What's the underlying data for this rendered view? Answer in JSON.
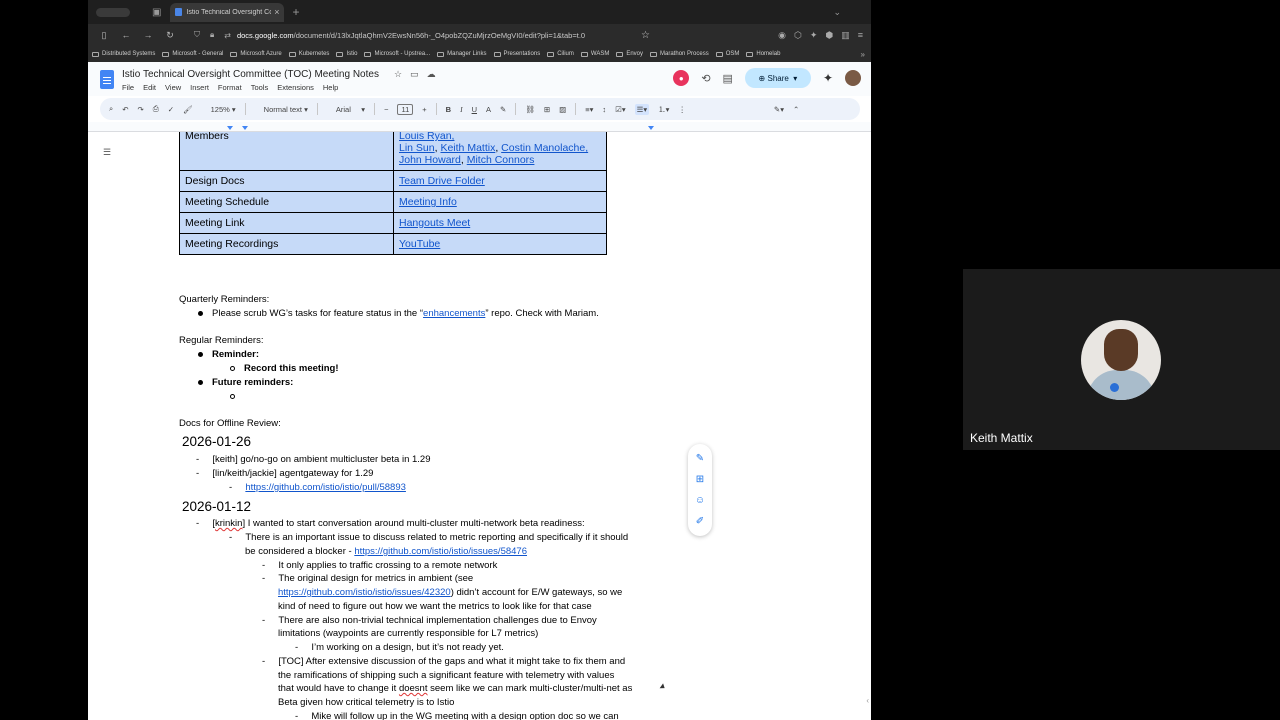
{
  "browser": {
    "tab_title": "Istio Technical Oversight Committee (TOC) Meeting Notes",
    "url_prefix": "docs.google.com",
    "url_rest": "/document/d/13lxJqtlaQhmV2EwsNn56h-_O4pobZQZuMjrzOeMgVI0/edit?pli=1&tab=t.0",
    "bookmarks": [
      "Distributed Systems",
      "Microsoft - General",
      "Microsoft Azure",
      "Kubernetes",
      "Istio",
      "Microsoft - Upstrea...",
      "Manager Links",
      "Presentations",
      "Cilium",
      "WASM",
      "Envoy",
      "Marathon Process",
      "OSM",
      "Homelab"
    ]
  },
  "docs": {
    "title": "Istio Technical Oversight Committee (TOC) Meeting Notes",
    "menus": [
      "File",
      "Edit",
      "View",
      "Insert",
      "Format",
      "Tools",
      "Extensions",
      "Help"
    ],
    "share_label": "Share",
    "zoom": "125%",
    "style": "Normal text",
    "font": "Arial",
    "font_size": "11"
  },
  "table": [
    {
      "key": "Members",
      "links": [
        [
          "Louis Ryan,"
        ],
        [
          "Lin Sun",
          ", ",
          "Keith Mattix",
          ", ",
          "Costin Manolache,"
        ],
        [
          "John Howard",
          ", ",
          "Mitch Connors"
        ]
      ]
    },
    {
      "key": "Design Docs",
      "value": "Team Drive Folder"
    },
    {
      "key": "Meeting Schedule",
      "value": "Meeting Info"
    },
    {
      "key": "Meeting Link",
      "value": "Hangouts Meet"
    },
    {
      "key": "Meeting Recordings",
      "value": "YouTube"
    }
  ],
  "content": {
    "quarterly_heading": "Quarterly Reminders:",
    "quarterly_pre": "Please scrub WG’s tasks for feature status in the “",
    "quarterly_link": "enhancements",
    "quarterly_post": "” repo. Check with Mariam.",
    "regular_heading": "Regular Reminders:",
    "reminder_label": "Reminder:",
    "record_label": "Record this meeting!",
    "future_label": "Future reminders:",
    "offline_heading": "Docs for Offline Review:",
    "date1": "2026-01-26",
    "d1_item1": "[keith] go/no-go on ambient multicluster beta in 1.29",
    "d1_item2": "[lin/keith/jackie] agentgateway for 1.29",
    "d1_link": "https://github.com/istio/istio/pull/58893",
    "date2": "2026-01-12",
    "d2_krinkin": "krinkin",
    "d2_item1": "] I wanted to start conversation around multi-cluster multi-network beta readiness:",
    "d2_sub1_a": "There is an important issue to discuss related to metric reporting and specifically if it should",
    "d2_sub1_b": "be considered a blocker - ",
    "d2_sub1_link": "https://github.com/istio/istio/issues/58476",
    "d2_s1": "It only applies to traffic crossing to a remote network",
    "d2_s2_a": "The original design for metrics in ambient (see",
    "d2_s2_link": "https://github.com/istio/istio/issues/42320",
    "d2_s2_b": ") didn’t account for E/W gateways, so we",
    "d2_s2_c": "kind of need to figure out how we want the metrics to look like for that case",
    "d2_s3_a": "There are also non-trivial technical implementation challenges due to Envoy",
    "d2_s3_b": "limitations (waypoints are currently responsible for L7 metrics)",
    "d2_s3_sub": "I’m working on a design, but it’s not ready yet.",
    "d2_s4_a": "[TOC] After extensive discussion of the gaps and what it might take to fix them and",
    "d2_s4_b": "the ramifications of shipping such a significant feature with telemetry with values",
    "d2_s4_c_pre": "that would have to change it ",
    "d2_s4_c_sq": "doesnt",
    "d2_s4_c_post": " seem like we can mark multi-cluster/multi-net as",
    "d2_s4_d": "Beta given how critical telemetry is to Istio",
    "d2_s4_sub": "Mike will follow up in the WG meeting with a design option doc so we can"
  },
  "meet": {
    "participant": "Keith Mattix"
  }
}
